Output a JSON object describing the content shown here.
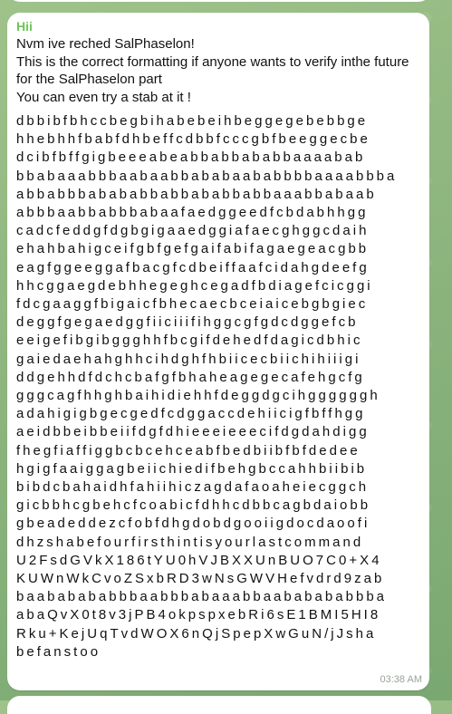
{
  "message": {
    "sender": "Hii",
    "intro": [
      "Nvm ive reched SalPhaselon!",
      "This is the correct formatting if anyone wants to verify inthe future for the SalPhaselon part",
      "You can even try a stab at it !"
    ],
    "code_lines": [
      "dbbibfbhccbegbihabebeihbeggegebebbge",
      "hhebhhfbabfdhbeffcdbbfcccgbfbeeggecbe",
      "dcibfbffgigbeeeabeabbabbababbaaaabab",
      "bbabaaabbbaabaabbababaababbbbaaaabbba",
      "abbabbbabababbabbababbabbaaabbabaab",
      "abbbaabbabbbabaafaedggeedfcbdabhhgg",
      "cadcfeddgfdgbgigaaedggiafaecghggcdaih",
      "ehahbahigceifgbfgefgaifabifagaegeacgbb",
      "eagfggeeggafbacgfcdbeiffaafcidahgdeefg",
      "hhcggaegdebhhegeghcegadfbdiagefcicggi",
      "fdcgaaggfbigaicfbhecaecbceiaicebgbgiec",
      "deggfgegaedggfiiciiifihggcgfgdcdggefcb",
      "eeigefibgibggghhfbcgifdehedfdagicdbhic",
      "gaiedaehahghhcihdghfhbiicecbiichihiiigi",
      "ddgehhdfdchcbafgfbhaheagegecafehgcfg",
      "gggcagfhhghbaihidiehhfdeggdgcihggggggh",
      "adahigigbgecgedfcdggaccdehiicigfbffhgg",
      "aeidbbeibbeiifdgfdhieeeieeecifdgdahdigg",
      "fhegfiaffiggbcbcehceabfbedbiibfbfdedee",
      "hgigfaaiggagbeiichiedifbehgbccahhbiibib",
      "bibdcbahaidhfahiihiczagdafaoaheiecggch",
      "gicbbhcgbehcfcoabicfdhhcdbbcagbdaiobb",
      "gbeadeddezcfobfdhgdobdgooiigdocdaoofi",
      "dhzshabefourfirsthintisyourlastcommand",
      "U2FsdGVkX186tYU0hVJBXXUnBUO7C0+X4",
      "KUWnWkCvoZSxbRD3wNsGWVHefvdrd9zab",
      "baababababbbaabbbabaaabbaababababbba",
      "abaQvX0t8v3jPB4okpspxebRi6sE1BMI5HI8",
      "Rku+KejUqTvdWOX6nQjSpepXwGuN/jJsha",
      "befanstoo"
    ],
    "time": "03:38 AM"
  }
}
